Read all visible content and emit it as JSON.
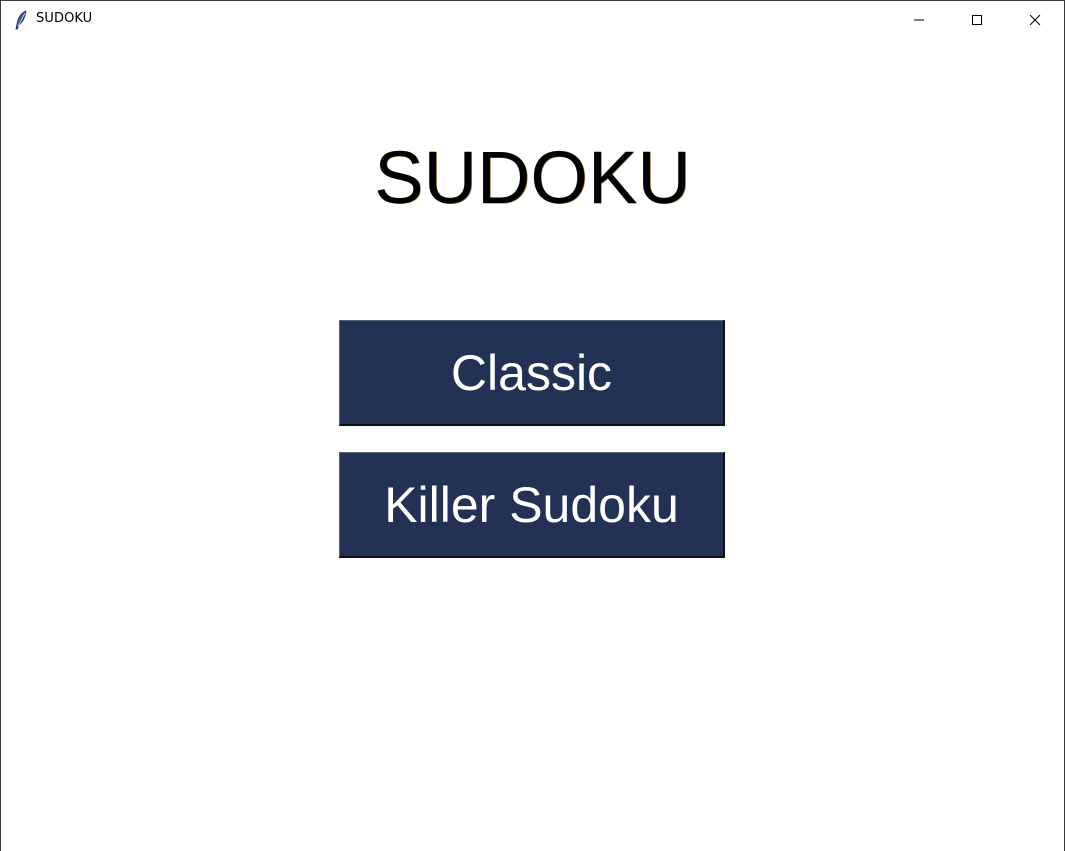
{
  "window": {
    "title": "SUDOKU",
    "icon": "feather-icon",
    "controls": [
      "minimize-icon",
      "maximize-icon",
      "close-icon"
    ]
  },
  "main": {
    "title": "SUDOKU",
    "buttons": {
      "classic_label": "Classic",
      "killer_label": "Killer Sudoku"
    }
  },
  "colors": {
    "button_bg": "#233254",
    "button_text": "#ffffff",
    "background": "#ffffff",
    "title_text": "#000000"
  }
}
